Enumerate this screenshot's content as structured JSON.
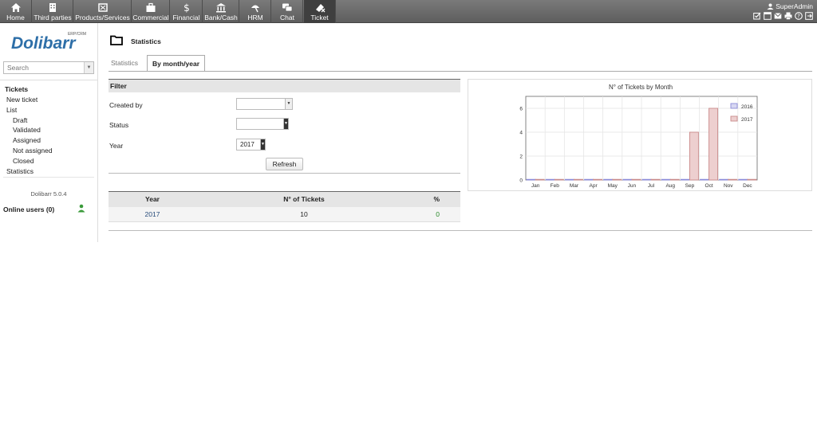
{
  "topmenu": {
    "items": [
      {
        "label": "Home",
        "icon": "home-icon"
      },
      {
        "label": "Third parties",
        "icon": "building-icon"
      },
      {
        "label": "Products/Services",
        "icon": "box-icon"
      },
      {
        "label": "Commercial",
        "icon": "briefcase-icon"
      },
      {
        "label": "Financial",
        "icon": "dollar-icon"
      },
      {
        "label": "Bank/Cash",
        "icon": "bank-icon"
      },
      {
        "label": "HRM",
        "icon": "umbrella-icon"
      },
      {
        "label": "Chat",
        "icon": "chat-icon"
      },
      {
        "label": "Ticket",
        "icon": "ticket-icon"
      }
    ],
    "active": "Ticket",
    "user": "SuperAdmin"
  },
  "left": {
    "logo_text": "Dolibarr",
    "logo_sub": "ERP/CRM",
    "search_placeholder": "Search",
    "nav": {
      "tickets": "Tickets",
      "new_ticket": "New ticket",
      "list": "List",
      "draft": "Draft",
      "validated": "Validated",
      "assigned": "Assigned",
      "not_assigned": "Not assigned",
      "closed": "Closed",
      "statistics": "Statistics"
    },
    "version": "Dolibarr 5.0.4",
    "online_users": "Online users (0)"
  },
  "page": {
    "title": "Statistics",
    "tabs": [
      "Statistics",
      "By month/year"
    ],
    "active_tab": "By month/year"
  },
  "filter": {
    "heading": "Filter",
    "created_by_label": "Created by",
    "created_by_value": "",
    "status_label": "Status",
    "status_value": "",
    "year_label": "Year",
    "year_value": "2017",
    "refresh_label": "Refresh"
  },
  "table": {
    "headers": [
      "Year",
      "N° of Tickets",
      "%"
    ],
    "rows": [
      {
        "year": "2017",
        "count": "10",
        "pct": "0"
      }
    ]
  },
  "colors": {
    "series_2016": "#8b8bd9",
    "series_2017": "#c98a8a"
  },
  "chart_data": {
    "type": "bar",
    "title": "N° of Tickets by Month",
    "categories": [
      "Jan",
      "Feb",
      "Mar",
      "Apr",
      "May",
      "Jun",
      "Jul",
      "Aug",
      "Sep",
      "Oct",
      "Nov",
      "Dec"
    ],
    "series": [
      {
        "name": "2016",
        "values": [
          0,
          0,
          0,
          0,
          0,
          0,
          0,
          0,
          0,
          0,
          0,
          0
        ]
      },
      {
        "name": "2017",
        "values": [
          0,
          0,
          0,
          0,
          0,
          0,
          0,
          0,
          4,
          6,
          0,
          0
        ]
      }
    ],
    "ylim": [
      0,
      7
    ],
    "yticks": [
      0,
      2,
      4,
      6
    ],
    "grid": true,
    "legend": "top-right"
  }
}
